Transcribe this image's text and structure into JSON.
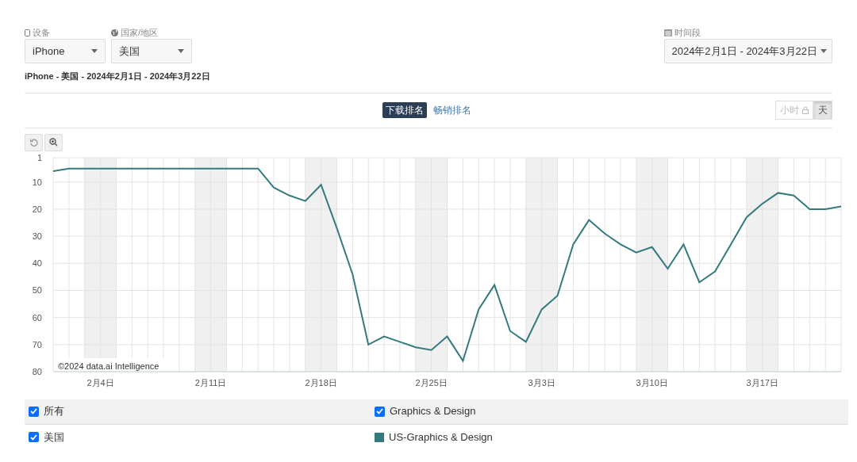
{
  "filters": [
    {
      "kind": "device",
      "label": "设备",
      "value": "iPhone"
    },
    {
      "kind": "region",
      "label": "国家/地区",
      "value": "美国"
    }
  ],
  "period": {
    "label": "时间段",
    "value": "2024年2月1日 - 2024年3月22日"
  },
  "subtitle": "iPhone - 美国 - 2024年2月1日 - 2024年3月22日",
  "rank_tabs": [
    {
      "label": "下载排名",
      "selected": true
    },
    {
      "label": "畅销排名",
      "selected": false
    }
  ],
  "granularity": [
    {
      "label": "小时",
      "selected": false,
      "disabled": true
    },
    {
      "label": "天",
      "selected": true,
      "disabled": false
    }
  ],
  "chart": {
    "credit": "©2024 data.ai Intelligence",
    "chart_data": {
      "type": "line",
      "categories": [
        null,
        null,
        null,
        "2月4日",
        null,
        null,
        null,
        null,
        null,
        null,
        "2月11日",
        null,
        null,
        null,
        null,
        null,
        null,
        "2月18日",
        null,
        null,
        null,
        null,
        null,
        null,
        "2月25日",
        null,
        null,
        null,
        null,
        null,
        null,
        "3月3日",
        null,
        null,
        null,
        null,
        null,
        null,
        "3月10日",
        null,
        null,
        null,
        null,
        null,
        null,
        "3月17日",
        null,
        null,
        null,
        null,
        null
      ],
      "series": [
        {
          "name": "US-Graphics & Design",
          "color": "#357a7e",
          "values": [
            6,
            5,
            5,
            5,
            5,
            5,
            5,
            5,
            5,
            5,
            5,
            5,
            5,
            5,
            12,
            15,
            17,
            11,
            27,
            44,
            70,
            67,
            69,
            71,
            72,
            67,
            76,
            57,
            48,
            65,
            69,
            57,
            52,
            33,
            24,
            29,
            33,
            36,
            34,
            42,
            33,
            47,
            43,
            33,
            23,
            18,
            14,
            15,
            20,
            20,
            19
          ]
        }
      ],
      "ylim": [
        80,
        1
      ],
      "yticks": [
        1,
        10,
        20,
        30,
        40,
        50,
        60,
        70,
        80
      ],
      "grid": true
    }
  },
  "legend": [
    {
      "group": {
        "label": "所有",
        "checked": true
      },
      "series": {
        "kind": "checkbox",
        "label": "Graphics & Design",
        "checked": true
      }
    },
    {
      "group": {
        "label": "美国",
        "checked": true
      },
      "series": {
        "kind": "swatch"
      }
    }
  ]
}
